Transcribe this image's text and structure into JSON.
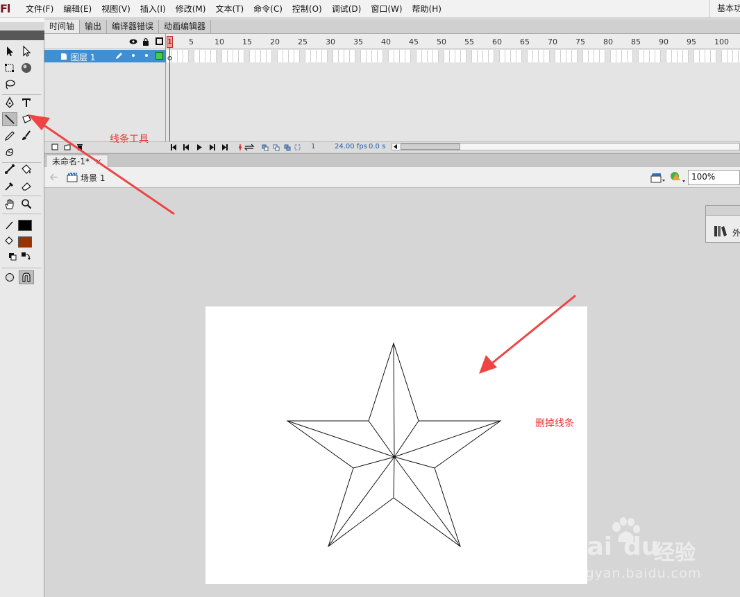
{
  "app": {
    "logo": "Fl",
    "workspace": "基本功"
  },
  "menu": [
    "文件(F)",
    "编辑(E)",
    "视图(V)",
    "插入(I)",
    "修改(M)",
    "文本(T)",
    "命令(C)",
    "控制(O)",
    "调试(D)",
    "窗口(W)",
    "帮助(H)"
  ],
  "panel_tabs": [
    "时间轴",
    "输出",
    "编译器错误",
    "动画编辑器"
  ],
  "timeline": {
    "layer_name": "图层 1",
    "current_frame": "1",
    "ruler": [
      "5",
      "10",
      "15",
      "20",
      "25",
      "30",
      "35",
      "40",
      "45",
      "50",
      "55",
      "60",
      "65",
      "70",
      "75",
      "80",
      "85",
      "90",
      "95",
      "100"
    ],
    "status_frame": "1",
    "fps": "24.00 fps",
    "time": "0.0 s"
  },
  "document": {
    "tab_title": "未命名-1*",
    "close": "×",
    "scene": "场景 1",
    "zoom": "100%"
  },
  "float_panel": {
    "label": "外"
  },
  "annotations": {
    "line_tool": "线条工具",
    "delete_lines": "删掉线条"
  },
  "colors": {
    "stroke": "#000000",
    "fill": "#993300",
    "annotation": "#e53935",
    "layer_highlight": "#3f8fd2"
  },
  "watermark": {
    "brand": "Bai",
    "brand2": "du",
    "cn": "经验",
    "url": "jingyan.baidu.com"
  }
}
